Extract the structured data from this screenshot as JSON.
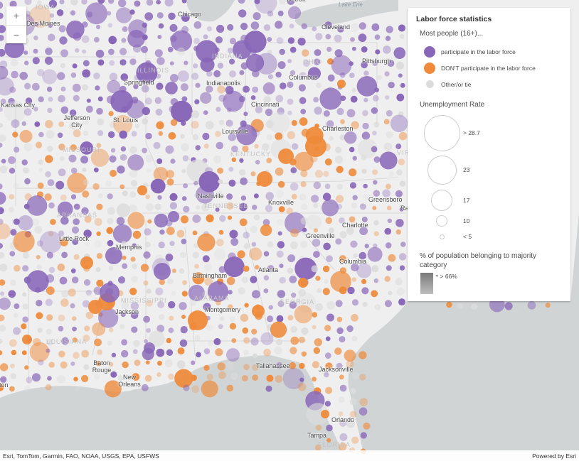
{
  "map": {
    "colors": {
      "land": "#efefef",
      "water": "#d1d4d5",
      "participate": "#8866b8",
      "not_participate": "#ee8a3a",
      "other": "#dcdcdc",
      "boundary": "#d8d8d8"
    },
    "cities": [
      {
        "name": "Chicago"
      },
      {
        "name": "Detroit"
      },
      {
        "name": "Des Moines"
      },
      {
        "name": "Cleveland"
      },
      {
        "name": "Pittsburgh"
      },
      {
        "name": "Columbus"
      },
      {
        "name": "Springfield"
      },
      {
        "name": "Indianapolis"
      },
      {
        "name": "Kansas City"
      },
      {
        "name": "Jefferson City"
      },
      {
        "name": "St. Louis"
      },
      {
        "name": "Cincinnati"
      },
      {
        "name": "Louisville"
      },
      {
        "name": "Charleston"
      },
      {
        "name": "Nashville"
      },
      {
        "name": "Knoxville"
      },
      {
        "name": "Greensboro"
      },
      {
        "name": "Charlotte"
      },
      {
        "name": "Memphis"
      },
      {
        "name": "Little Rock"
      },
      {
        "name": "Greenville"
      },
      {
        "name": "Birmingham"
      },
      {
        "name": "Atlanta"
      },
      {
        "name": "Columbia"
      },
      {
        "name": "Jackson"
      },
      {
        "name": "Montgomery"
      },
      {
        "name": "Baton Rouge"
      },
      {
        "name": "New Orleans"
      },
      {
        "name": "Tallahassee"
      },
      {
        "name": "Jacksonville"
      },
      {
        "name": "Orlando"
      },
      {
        "name": "Tampa"
      },
      {
        "name": "Houston"
      },
      {
        "name": "Raleigh"
      }
    ],
    "states": [
      "IOWA",
      "ILLINOIS",
      "INDIANA",
      "OHIO",
      "MISSOURI",
      "KENTUCKY",
      "TENNESSEE",
      "ARKANSAS",
      "MISSISSIPPI",
      "ALABAMA",
      "GEORGIA",
      "LOUISIANA",
      "FLORIDA",
      "VIRGINIA"
    ],
    "water_labels": [
      "Lake Erie"
    ]
  },
  "zoom": {
    "in_label": "+",
    "out_label": "−"
  },
  "legend": {
    "title": "Labor force statistics",
    "subtitle": "Most people (16+)...",
    "categories": [
      {
        "label": "participate in the labor force",
        "color": "#8866b8"
      },
      {
        "label": "DON'T participate in the labor force",
        "color": "#ee8a3a"
      },
      {
        "label": "Other/or tie",
        "color": "#dcdcdc"
      }
    ],
    "size_title": "Unemployment Rate",
    "sizes": [
      {
        "label": "> 28.7"
      },
      {
        "label": "23"
      },
      {
        "label": "17"
      },
      {
        "label": "10"
      },
      {
        "label": "< 5"
      }
    ],
    "opacity_title": "% of population belonging to majority category",
    "opacity_label": "> 66%"
  },
  "attribution": {
    "sources": "Esri, TomTom, Garmin, FAO, NOAA, USGS, EPA, USFWS",
    "powered_by": "Powered by Esri"
  }
}
